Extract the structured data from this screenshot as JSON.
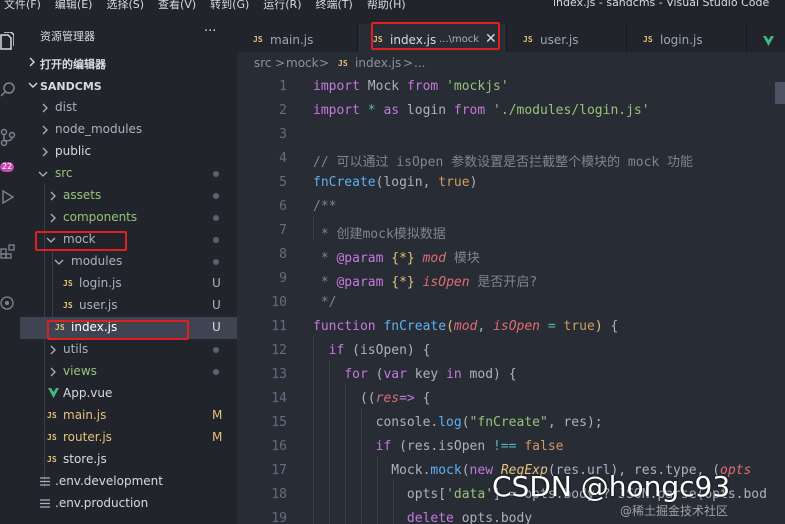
{
  "menu": [
    "文件(F)",
    "编辑(E)",
    "选择(S)",
    "查看(V)",
    "转到(G)",
    "运行(R)",
    "终端(T)",
    "帮助(H)"
  ],
  "window_title": "index.js - sandcms - Visual Studio Code",
  "activity": {
    "badge": "22"
  },
  "sidebar": {
    "title": "资源管理器",
    "more": "···",
    "open_editors": "打开的编辑器",
    "project": "SANDCMS",
    "tree": [
      {
        "label": "dist"
      },
      {
        "label": "node_modules"
      },
      {
        "label": "public"
      },
      {
        "label": "src"
      },
      {
        "label": "assets"
      },
      {
        "label": "components"
      },
      {
        "label": "mock"
      },
      {
        "label": "modules"
      },
      {
        "label": "login.js",
        "status": "U"
      },
      {
        "label": "user.js",
        "status": "U"
      },
      {
        "label": "index.js",
        "status": "U"
      },
      {
        "label": "utils"
      },
      {
        "label": "views"
      },
      {
        "label": "App.vue"
      },
      {
        "label": "main.js",
        "status": "M"
      },
      {
        "label": "router.js",
        "status": "M"
      },
      {
        "label": "store.js"
      },
      {
        "label": ".env.development"
      },
      {
        "label": ".env.production"
      }
    ],
    "js_badge": "JS"
  },
  "tabs": [
    {
      "name": "main.js"
    },
    {
      "name": "index.js",
      "desc": "...\\mock"
    },
    {
      "name": "user.js"
    },
    {
      "name": "login.js"
    }
  ],
  "breadcrumb": [
    "src",
    ">",
    "mock",
    ">",
    "index.js",
    ">",
    "..."
  ],
  "code": {
    "line_numbers": [
      "1",
      "2",
      "3",
      "4",
      "5",
      "6",
      "7",
      "8",
      "9",
      "10",
      "11",
      "12",
      "13",
      "14",
      "15",
      "16",
      "17",
      "18",
      "19"
    ]
  },
  "watermark": "CSDN @hongc93",
  "watermark_sub": "@稀土掘金技术社区"
}
